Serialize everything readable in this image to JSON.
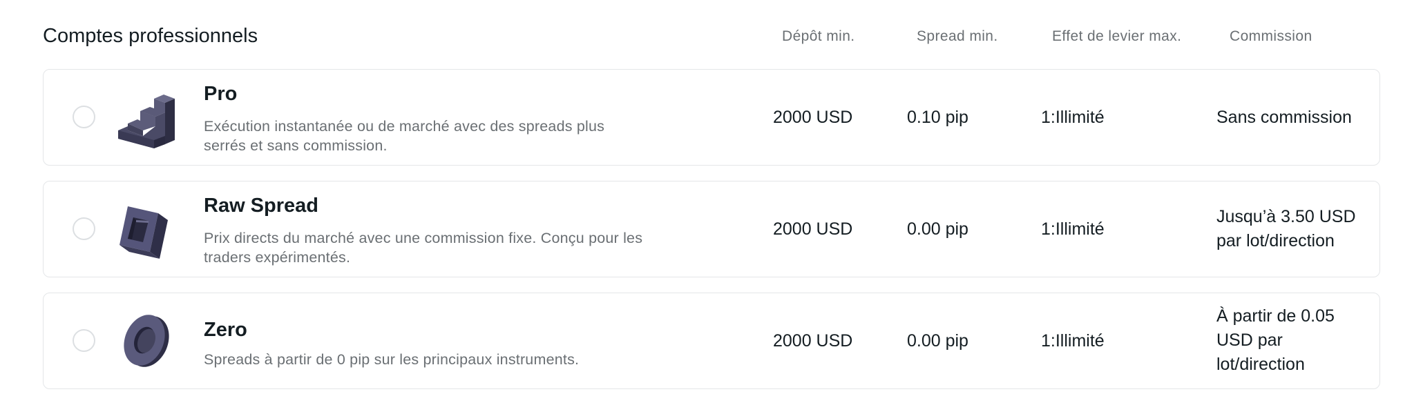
{
  "header": {
    "title": "Comptes professionnels",
    "columns": {
      "deposit": "Dépôt min.",
      "spread": "Spread min.",
      "leverage": "Effet de levier max.",
      "commission": "Commission"
    }
  },
  "accounts": [
    {
      "icon": "stairs-icon",
      "name": "Pro",
      "description": "Exécution instantanée ou de marché avec des spreads plus serrés et sans commission.",
      "deposit": "2000 USD",
      "spread": "0.10 pip",
      "leverage": "1:Illimité",
      "commission": "Sans commission"
    },
    {
      "icon": "frame-block-icon",
      "name": "Raw Spread",
      "description": "Prix directs du marché avec une commission fixe. Conçu pour les traders expérimentés.",
      "deposit": "2000 USD",
      "spread": "0.00 pip",
      "leverage": "1:Illimité",
      "commission": "Jusqu’à 3.50 USD par lot/direction"
    },
    {
      "icon": "ring-icon",
      "name": "Zero",
      "description": "Spreads à partir de 0 pip sur les principaux instruments.",
      "deposit": "2000 USD",
      "spread": "0.00 pip",
      "leverage": "1:Illimité",
      "commission": "À partir de 0.05 USD par lot/direction"
    }
  ],
  "colors": {
    "border": "#e4e6e8",
    "text": "#141d22",
    "muted": "#6a6f73",
    "icon": "#4a4a66"
  }
}
